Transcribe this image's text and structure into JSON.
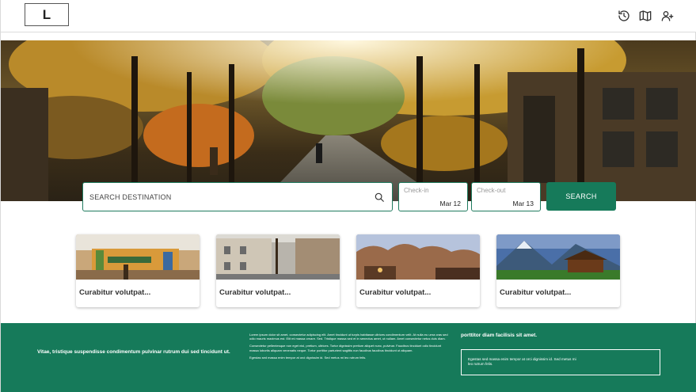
{
  "header": {
    "logo_text": "L",
    "icons": [
      "history-icon",
      "map-icon",
      "user-settings-icon"
    ]
  },
  "search": {
    "placeholder": "SEARCH DESTINATION",
    "check_in": {
      "label": "Check-in",
      "value": "Mar 12"
    },
    "check_out": {
      "label": "Check-out",
      "value": "Mar 13"
    },
    "button_label": "SEARCH"
  },
  "cards": [
    {
      "title": "Curabitur volutpat..."
    },
    {
      "title": "Curabitur volutpat..."
    },
    {
      "title": "Curabitur volutpat..."
    },
    {
      "title": "Curabitur volutpat..."
    }
  ],
  "footer": {
    "left_text": "Vitae, tristique suspendisse condimentum pulvinar rutrum dui sed tincidunt ut.",
    "mid_paragraphs": [
      "Lorem ipsum dolor sit amet, consectetur adipiscing elit. Amet tincidunt ut turpis habitasse ultrices condimentum velit. At nulla eu urna cras sed odio mauris maximus est. Elit mi massa ornare. Sed. Tristique massa sed et in senectus amet, ut nullam. Amet consectetur netus duis diam.",
      "Consectetur pellentesque non eget nisl, pretium, ultrices. Tortor dignissim pretium aliquet nunc, pulvinar. Faucibus tincidunt odio tincidunt massa lobortis aliquam venenatis neque. Tortor porttitor parturient sagittis non faucibus faucibus tincidunt ut aliquam.",
      "Egestas sed massa enim tempor at orci dignissim id. Sed metus mi leo rutrum felis."
    ],
    "right_title": "porttitor diam facilisis sit amet.",
    "right_panel_text": "Egestas sed massa enim tempor at orci dignissim id. Sed metus mi leo rutrum felis."
  },
  "colors": {
    "brand_green": "#167a5a",
    "border_green": "#1f7a5e"
  }
}
